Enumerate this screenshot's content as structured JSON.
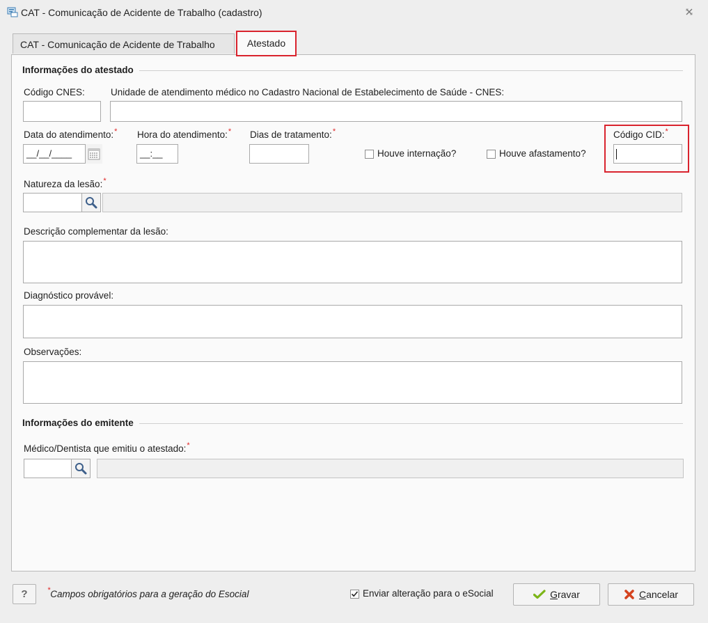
{
  "window": {
    "title": "CAT - Comunicação de Acidente de Trabalho (cadastro)"
  },
  "tabs": [
    {
      "label": "CAT - Comunicação de Acidente de Trabalho",
      "active": false
    },
    {
      "label": "Atestado",
      "active": true
    }
  ],
  "atestado": {
    "section_title": "Informações do atestado",
    "cnes_code_label": "Código CNES:",
    "cnes_unit_label": "Unidade de atendimento médico no Cadastro Nacional de Estabelecimento de Saúde - CNES:",
    "date_label": "Data do atendimento:",
    "date_value": "__/__/____",
    "time_label": "Hora do atendimento:",
    "time_value": "__:__",
    "treatment_days_label": "Dias de tratamento:",
    "hospitalization_label": "Houve internação?",
    "leave_label": "Houve afastamento?",
    "cid_label": "Código CID:",
    "injury_nature_label": "Natureza da lesão:",
    "injury_description_label": "Descrição complementar da lesão:",
    "diagnosis_label": "Diagnóstico provável:",
    "notes_label": "Observações:",
    "required_mark": "*"
  },
  "emitente": {
    "section_title": "Informações do emitente",
    "doctor_label": "Médico/Dentista que emitiu o atestado:"
  },
  "footer": {
    "help_label": "?",
    "required_note": "Campos obrigatórios para a geração do Esocial",
    "send_esocial_label": "Enviar alteração para o eSocial",
    "send_esocial_checked": true,
    "save_label_underlined": "G",
    "save_label_rest": "ravar",
    "cancel_label_underlined": "C",
    "cancel_label_rest": "ancelar"
  },
  "colors": {
    "highlight": "#d9232d",
    "required_asterisk": "#e02424",
    "save_check": "#7cb518",
    "cancel_x": "#d4431f"
  },
  "icons": {
    "title": "app-window-icon",
    "close": "close-icon",
    "calendar": "calendar-icon",
    "search": "search-icon",
    "check": "checkmark-icon",
    "cancel": "x-icon"
  }
}
